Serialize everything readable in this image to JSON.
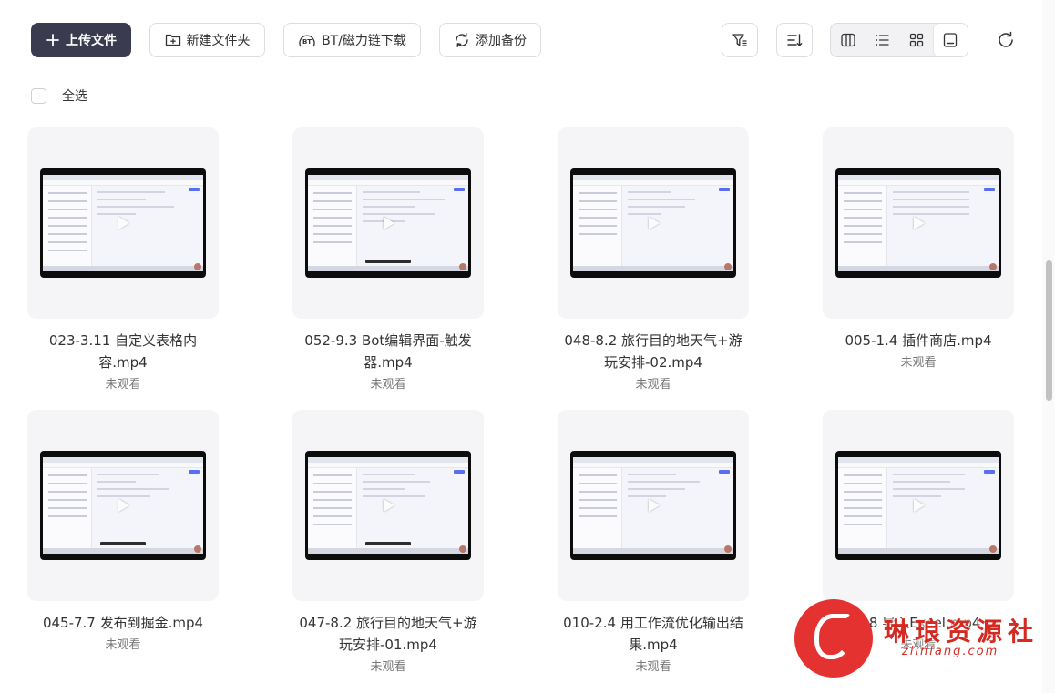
{
  "toolbar": {
    "upload_label": "上传文件",
    "new_folder_label": "新建文件夹",
    "bt_label": "BT/磁力链下载",
    "add_backup_label": "添加备份",
    "view_modes": [
      "columns",
      "list",
      "grid",
      "preview"
    ],
    "active_view": "preview"
  },
  "select_all_label": "全选",
  "files": [
    {
      "name": "023-3.11 自定义表格内容.mp4",
      "status": "未观看"
    },
    {
      "name": "052-9.3 Bot编辑界面-触发器.mp4",
      "status": "未观看"
    },
    {
      "name": "048-8.2 旅行目的地天气+游玩安排-02.mp4",
      "status": "未观看"
    },
    {
      "name": "005-1.4 插件商店.mp4",
      "status": "未观看"
    },
    {
      "name": "045-7.7 发布到掘金.mp4",
      "status": "未观看"
    },
    {
      "name": "047-8.2 旅行目的地天气+游玩安排-01.mp4",
      "status": "未观看"
    },
    {
      "name": "010-2.4 用工作流优化输出结果.mp4",
      "status": "未观看"
    },
    {
      "name": "3.8 导入Excel.mp4",
      "status": "未观看"
    }
  ],
  "watermark": {
    "text": "琳琅资源社",
    "url": "zlinlang.com"
  }
}
